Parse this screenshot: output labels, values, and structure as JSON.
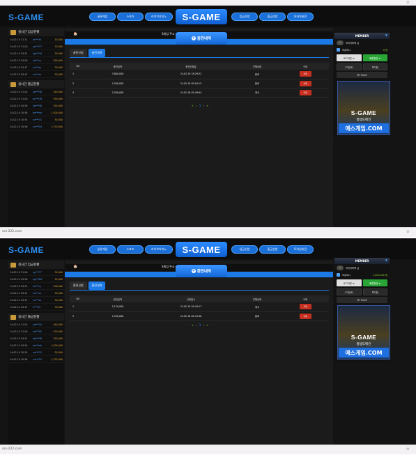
{
  "browser": {
    "url": "sss-222.com"
  },
  "header": {
    "logo": "S-GAME",
    "center_logo": "S-GAME",
    "nav_left": [
      "슬롯게임",
      "스포츠",
      "라이브카지노"
    ],
    "nav_right": [
      "입금신청",
      "출금신청",
      "모바일버전"
    ]
  },
  "sidebar": {
    "deposit_title": "실시간 입금현황",
    "withdraw_title": "실시간 출금현황",
    "deposits_s1": [
      {
        "date": "24-02-19 21:11",
        "user": "ta***44",
        "amount": "10,000"
      },
      {
        "date": "24-02-19 21:00",
        "user": "sy***77",
        "amount": "70,000"
      },
      {
        "date": "24-02-19 20:51",
        "user": "kg***34",
        "amount": "30,000"
      },
      {
        "date": "24-02-19 20:50",
        "user": "so***ry",
        "amount": "300,000"
      },
      {
        "date": "24-02-19 20:47",
        "user": "su***ss",
        "amount": "30,000"
      },
      {
        "date": "24-02-19 20:47",
        "user": "su***ss",
        "amount": "50,000"
      }
    ],
    "withdrawals_s1": [
      {
        "date": "24-02-19 21:04",
        "user": "so***38",
        "amount": "440,000"
      },
      {
        "date": "24-02-19 21:00",
        "user": "gu***28",
        "amount": "390,000"
      },
      {
        "date": "24-02-19 20:56",
        "user": "kg***58",
        "amount": "250,000"
      },
      {
        "date": "24-02-19 20:56",
        "user": "be***ok",
        "amount": "1,500,000"
      },
      {
        "date": "24-02-19 20:55",
        "user": "su***31",
        "amount": "50,000"
      },
      {
        "date": "24-02-19 20:56",
        "user": "su***19",
        "amount": "1,370,000"
      }
    ],
    "deposits_s2": [
      {
        "date": "24-02-19 21:00",
        "user": "sy***77",
        "amount": "30,000"
      },
      {
        "date": "24-02-19 20:56",
        "user": "kg***84",
        "amount": "30,000"
      },
      {
        "date": "24-02-19 20:51",
        "user": "so***ry",
        "amount": "300,000"
      },
      {
        "date": "24-02-19 20:47",
        "user": "su***ss",
        "amount": "30,000"
      },
      {
        "date": "24-02-19 20:47",
        "user": "su***ss",
        "amount": "30,000"
      },
      {
        "date": "24-02-19 20:47",
        "user": "2***25",
        "amount": "30,000"
      }
    ],
    "withdrawals_s2": [
      {
        "date": "24-02-19 21:04",
        "user": "so***34",
        "amount": "440,000"
      },
      {
        "date": "24-02-19 21:00",
        "user": "ss***28",
        "amount": "430,000"
      },
      {
        "date": "24-02-19 20:51",
        "user": "kg***58",
        "amount": "250,000"
      },
      {
        "date": "24-02-19 20:50",
        "user": "be***ok",
        "amount": "1,500,000"
      },
      {
        "date": "24-02-19 20:55",
        "user": "su***31",
        "amount": "30,000"
      },
      {
        "date": "24-02-19 20:56",
        "user": "su***19",
        "amount": "1,370,000"
      }
    ]
  },
  "breadcrumb": {
    "home": "🏠",
    "site_s1": "S게임 주소 ▾",
    "site_s2": "S게임 주소 ▾"
  },
  "screen1": {
    "title": "충전내역",
    "tabs": [
      "충전신청",
      "충전내역"
    ],
    "columns": [
      "NO",
      "충전금액",
      "충전신청일",
      "진행상태",
      "삭제"
    ],
    "rows": [
      {
        "no": "1",
        "amount": "3,800,000",
        "date": "24.02.19 18:29:32",
        "status": "완료",
        "action": "삭제"
      },
      {
        "no": "2",
        "amount": "2,500,000",
        "date": "24.02.19 02:04:15",
        "status": "완료",
        "action": "삭제"
      },
      {
        "no": "3",
        "amount": "2,500,000",
        "date": "24.02.18 01:49:04",
        "status": "취소",
        "action": "삭제"
      }
    ],
    "pager": {
      "prev": "«",
      "prev1": "‹",
      "current": "1",
      "next1": "›",
      "next": "»"
    }
  },
  "screen2": {
    "title": "환전내역",
    "tabs": [
      "환전신청",
      "환전내역"
    ],
    "columns": [
      "NO",
      "환전금액",
      "신청일시",
      "진행상태",
      "삭제"
    ],
    "rows": [
      {
        "no": "1",
        "amount": "5,170,000",
        "date": "24.02.19 20:43:17",
        "status": "취소",
        "action": "삭제"
      },
      {
        "no": "2",
        "amount": "2,530,000",
        "date": "24.02.18 04:43:46",
        "status": "완료",
        "action": "삭제"
      }
    ],
    "pager": {
      "prev": "«",
      "prev1": "‹",
      "current": "1",
      "next1": "›",
      "next": "»"
    }
  },
  "member": {
    "title": "MEMBER",
    "level_badge": "LV",
    "username": "마지막퍼펙 님",
    "balance_label": "보유머니",
    "balance_value_s1": "0 원",
    "balance_value_s2": "1,000,000 원",
    "logout": "로그아웃 ⊕",
    "charge": "빠른충전 ⊕",
    "support": "고객센터",
    "messages": "쪽지함",
    "mypage": "MY PAGE"
  },
  "banner": {
    "logo": "S-GAME",
    "subtitle": "평생도메인",
    "domain": "에스게임.COM"
  }
}
